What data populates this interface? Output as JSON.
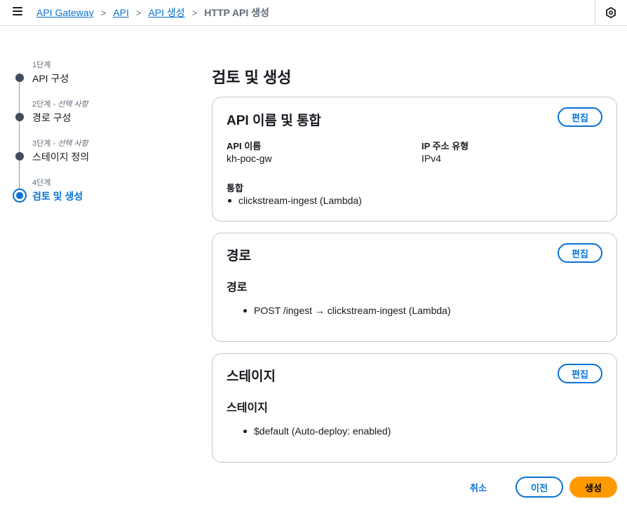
{
  "breadcrumbs": {
    "items": [
      "API Gateway",
      "API",
      "API 생성"
    ],
    "current": "HTTP API 생성",
    "separator": ">"
  },
  "steps": [
    {
      "step": "1단계",
      "optional": "",
      "title": "API 구성"
    },
    {
      "step": "2단계",
      "optional": "선택 사항",
      "title": "경로 구성"
    },
    {
      "step": "3단계",
      "optional": "선택 사항",
      "title": "스테이지 정의"
    },
    {
      "step": "4단계",
      "optional": "",
      "title": "검토 및 생성"
    }
  ],
  "page_title": "검토 및 생성",
  "cards": {
    "api": {
      "title": "API 이름 및 통합",
      "edit_label": "편집",
      "name_label": "API 이름",
      "name_value": "kh-poc-gw",
      "ip_label": "IP 주소 유형",
      "ip_value": "IPv4",
      "integration_label": "통합",
      "integration_item": "clickstream-ingest (Lambda)"
    },
    "routes": {
      "title": "경로",
      "edit_label": "편집",
      "subheading": "경로",
      "item": "POST /ingest → clickstream-ingest (Lambda)"
    },
    "stages": {
      "title": "스테이지",
      "edit_label": "편집",
      "subheading": "스테이지",
      "item": "$default (Auto-deploy: enabled)"
    }
  },
  "footer": {
    "cancel_label": "취소",
    "previous_label": "이전",
    "create_label": "생성"
  },
  "colors": {
    "accent": "#0972d3",
    "primary_button": "#ff9900"
  },
  "icons": [
    "menu-icon",
    "chevron-right-icon",
    "hexagon-settings-icon"
  ]
}
